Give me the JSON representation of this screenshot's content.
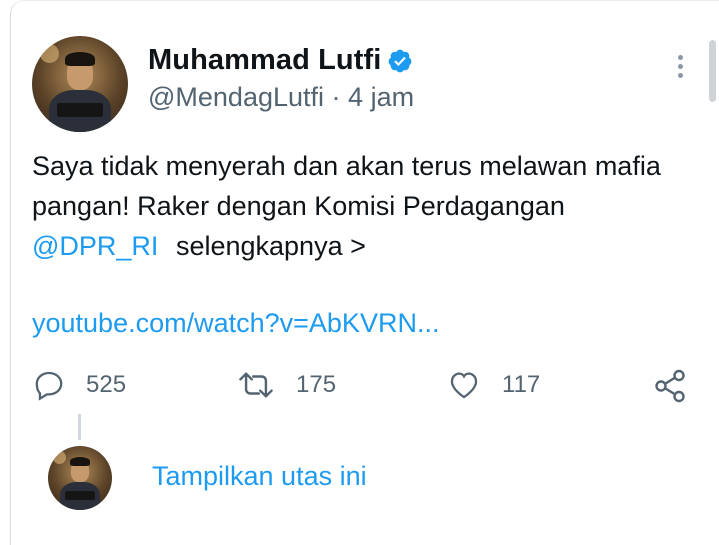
{
  "tweet": {
    "author": {
      "display_name": "Muhammad Lutfi",
      "handle": "@MendagLutfi",
      "separator": "·",
      "time": "4 jam",
      "verified": true
    },
    "text_part1": "Saya tidak menyerah dan akan terus melawan mafia pangan! Raker dengan Komisi Perdagangan ",
    "mention": "@DPR_RI",
    "more_link": "selengkapnya >",
    "link": "youtube.com/watch?v=AbKVRN...",
    "actions": {
      "reply_count": "525",
      "retweet_count": "175",
      "like_count": "117"
    }
  },
  "thread": {
    "show_thread_label": "Tampilkan utas ini"
  },
  "colors": {
    "accent": "#1d9bf0",
    "text": "#0f1419",
    "secondary": "#536471"
  },
  "icons": [
    "verified-badge-icon",
    "more-options-icon",
    "reply-icon",
    "retweet-icon",
    "like-icon",
    "share-icon"
  ]
}
